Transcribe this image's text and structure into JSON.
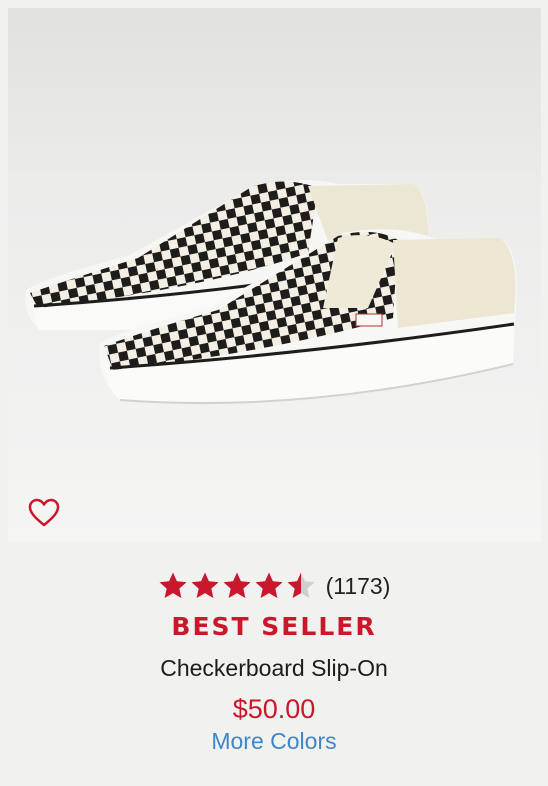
{
  "product": {
    "image_alt": "Checkerboard Slip-On shoes",
    "favorite_icon": "heart-outline-icon",
    "rating": {
      "value": 4.5,
      "max": 5,
      "count_text": "(1173)"
    },
    "badge": "BEST SELLER",
    "name": "Checkerboard Slip-On",
    "price": "$50.00",
    "more_colors_label": "More Colors"
  },
  "colors": {
    "star": "#c9182b",
    "star_empty": "#cfcfcf",
    "price": "#c9182b",
    "link": "#3f86c9"
  }
}
